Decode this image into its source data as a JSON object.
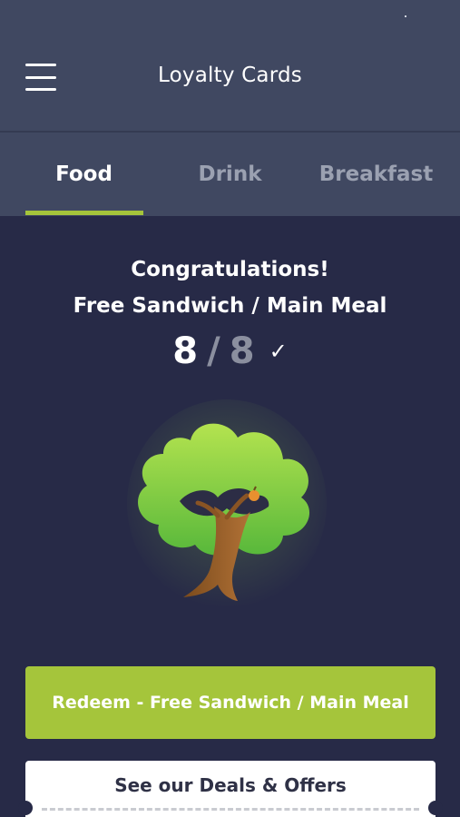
{
  "header": {
    "title": "Loyalty Cards",
    "menu_icon": "hamburger-icon"
  },
  "tabs": [
    {
      "label": "Food",
      "active": true
    },
    {
      "label": "Drink",
      "active": false
    },
    {
      "label": "Breakfast",
      "active": false
    }
  ],
  "reward": {
    "heading": "Congratulations!",
    "name": "Free Sandwich / Main Meal",
    "stamps_collected": "8",
    "separator": "/",
    "stamps_total": "8",
    "complete_icon": "checkmark-icon"
  },
  "illustration": {
    "icon": "tree-icon"
  },
  "actions": {
    "redeem_label": "Redeem - Free Sandwich / Main Meal",
    "deals_label": "See our Deals & Offers"
  },
  "colors": {
    "background": "#272a47",
    "header": "#404861",
    "accent": "#a5c53b",
    "inactive_tab": "#9ba1b1"
  }
}
